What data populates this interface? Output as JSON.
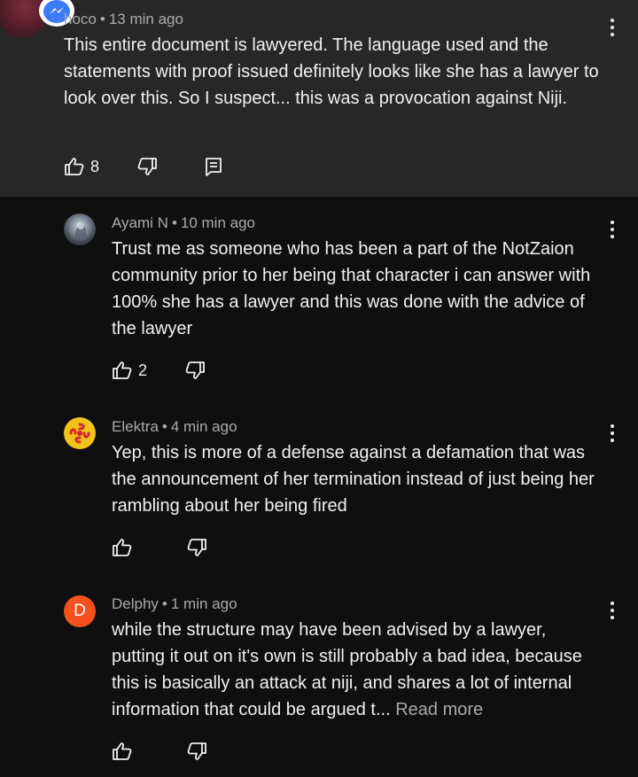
{
  "comments": [
    {
      "author": "Choco",
      "author_display": "hoco",
      "time": "13 min ago",
      "text": "This entire document is lawyered. The language used and the statements with proof issued definitely looks like she has a lawyer to look over this. So I suspect... this was a provocation against Niji.",
      "likes": "8",
      "highlighted": true
    },
    {
      "author": "Ayami N",
      "time": "10 min ago",
      "text": "Trust me as someone who has been a part of the NotZaion community prior to her being that character i can answer with 100% she has a lawyer and this was done with the advice of the lawyer",
      "likes": "2"
    },
    {
      "author": "Elektra",
      "time": "4 min ago",
      "text": "Yep, this is more of a defense against a defamation that was the announcement of her termination instead of just being her rambling about her being fired",
      "likes": ""
    },
    {
      "author": "Delphy",
      "time": "1 min ago",
      "avatar_letter": "D",
      "text": "while the structure may have been advised by a lawyer, putting it out on it's own is still probably a bad idea, because this is basically an attack at niji, and shares a lot of internal information that could be argued t...",
      "read_more": "Read more",
      "likes": ""
    }
  ],
  "separator": "•",
  "colors": {
    "background": "#0f0f0f",
    "highlight_background": "#272727",
    "text": "#f1f1f1",
    "meta": "#aaaaaa",
    "delphy_avatar": "#f4511e",
    "elektra_avatar": "#f2c31b",
    "messenger_badge": "#3b7cf6"
  },
  "icons": [
    "messenger-icon",
    "thumbs-up-icon",
    "thumbs-down-icon",
    "reply-icon",
    "more-vert-icon"
  ]
}
